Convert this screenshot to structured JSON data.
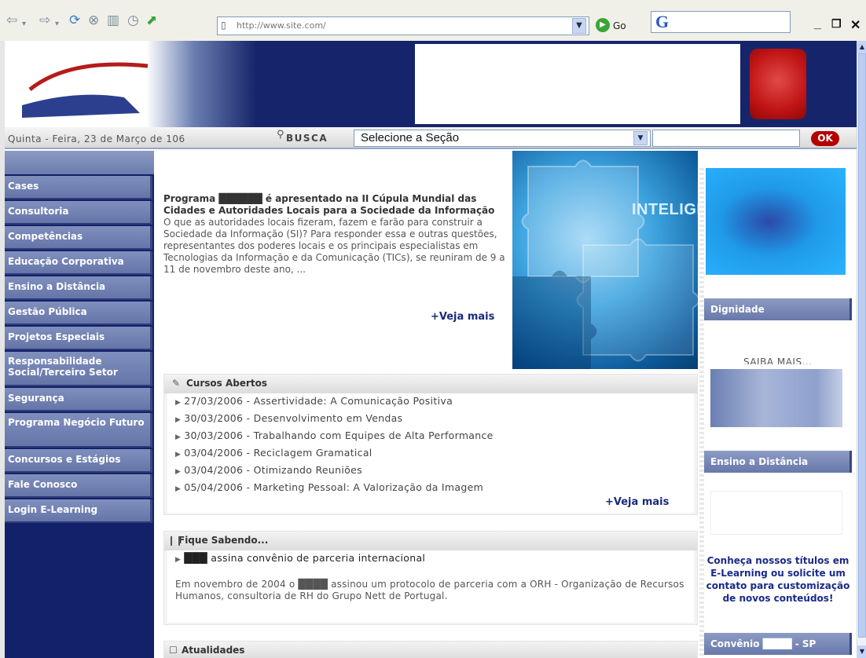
{
  "browser": {
    "url": "http://www.site.com/",
    "go_label": "Go",
    "colors": {
      "chrome": "#f0f0e8",
      "go_green": "#3aa43a"
    }
  },
  "header": {
    "date": "Quinta - Feira, 23 de Março de 106",
    "busca_label": "BUSCA",
    "section_select": "Selecione a Seção",
    "ok_label": "OK"
  },
  "menu": {
    "items": [
      "Cases",
      "Consultoria",
      "Competências",
      "Educação Corporativa",
      "Ensino a Distância",
      "Gestão Pública",
      "Projetos Especiais",
      "Responsabilidade Social/Terceiro Setor",
      "Segurança",
      "Programa Negócio Futuro",
      "Concursos e Estágios",
      "Fale Conosco",
      "Login E-Learning"
    ]
  },
  "feature": {
    "title": "Programa ██████ é apresentado na II Cúpula Mundial das Cidades e Autoridades Locais para a Sociedade da Informação",
    "body": "O que as autoridades locais fizeram, fazem e farão para construir a Sociedade da Informação (SI)? Para responder essa e outras questões, representantes dos poderes locais e os principais especialistas em Tecnologias da Informação e da Comunicação (TICs), se reuniram de 9 a 11 de novembro deste ano, ...",
    "more": "+Veja mais",
    "image_text": "INTELIGÊ"
  },
  "courses": {
    "title": "Cursos Abertos",
    "items": [
      "27/03/2006 - Assertividade: A Comunicação Positiva",
      "30/03/2006 - Desenvolvimento em Vendas",
      "30/03/2006 - Trabalhando com Equipes de Alta Performance",
      "03/04/2006 - Reciclagem Gramatical",
      "03/04/2006 - Otimizando Reuniões",
      "05/04/2006 - Marketing Pessoal: A Valorização da Imagem"
    ],
    "more": "+Veja mais"
  },
  "news": {
    "title": "Fique Sabendo...",
    "headline": "███ assina convênio de parceria internacional",
    "body": "Em novembro de 2004 o ████ assinou um protocolo de parceria com a ORH - Organização de Recursos Humanos, consultoria de RH do Grupo Nett de Portugal."
  },
  "updates": {
    "title": "Atualidades"
  },
  "right": {
    "dignidade": "Dignidade",
    "saiba_mais": "SAIBA MAIS...",
    "ead_title": "Ensino a Distância",
    "ead_text": "Conheça nossos títulos em E-Learning ou solicite um contato para customização de novos conteúdos!",
    "convenio": "Convênio ████ - SP"
  }
}
